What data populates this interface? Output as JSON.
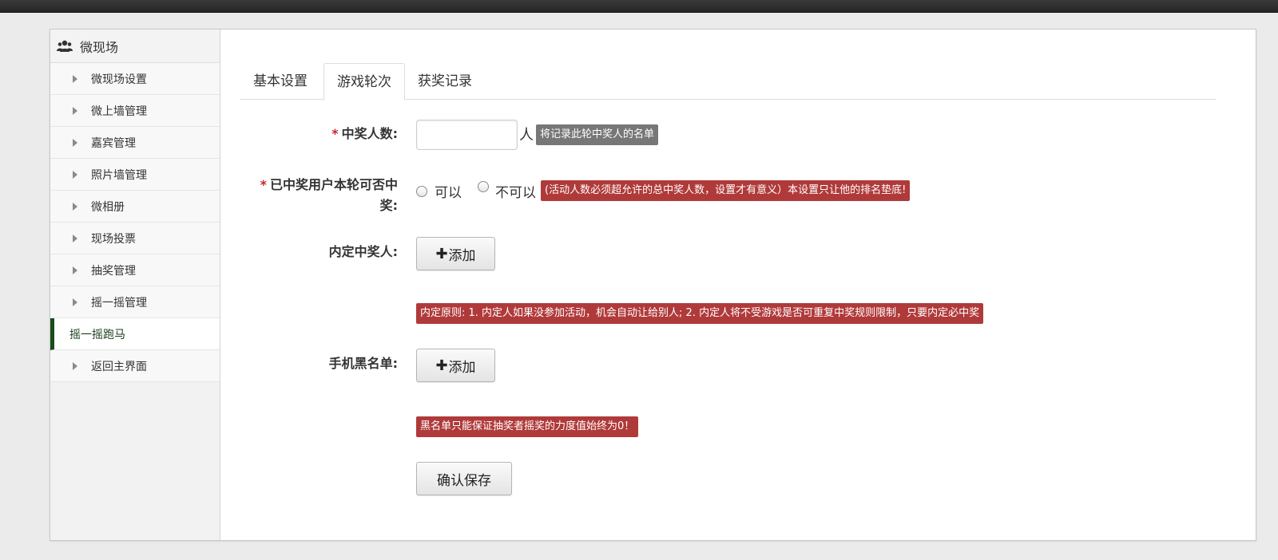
{
  "sidebar": {
    "title": "微现场",
    "title_icon": "users-icon",
    "items": [
      {
        "label": "微现场设置"
      },
      {
        "label": "微上墙管理"
      },
      {
        "label": "嘉宾管理"
      },
      {
        "label": "照片墙管理"
      },
      {
        "label": "微相册"
      },
      {
        "label": "现场投票"
      },
      {
        "label": "抽奖管理"
      },
      {
        "label": "摇一摇管理"
      },
      {
        "label": "摇一摇跑马",
        "active": true
      },
      {
        "label": "返回主界面"
      }
    ],
    "active_color": "#1a4c1a"
  },
  "tabs": [
    {
      "label": "基本设置"
    },
    {
      "label": "游戏轮次",
      "active": true
    },
    {
      "label": "获奖记录"
    }
  ],
  "form": {
    "winners_count": {
      "required_mark": "*",
      "label": "中奖人数:",
      "value": "",
      "unit": "人",
      "hint": "将记录此轮中奖人的名单"
    },
    "repeat_win": {
      "required_mark": "*",
      "label_line1": "已中奖用户本轮可否中",
      "label_line2": "奖:",
      "options": [
        "可以",
        "不可以"
      ],
      "selected": null,
      "hint": "(活动人数必须超允许的总中奖人数，设置才有意义）本设置只让他的排名垫底!"
    },
    "preset_winners": {
      "label": "内定中奖人:",
      "button_label": "添加",
      "note": "内定原则: 1. 内定人如果没参加活动，机会自动让给别人; 2. 内定人将不受游戏是否可重复中奖规则限制，只要内定必中奖"
    },
    "phone_blacklist": {
      "label": "手机黑名单:",
      "button_label": "添加",
      "note": "黑名单只能保证抽奖者摇奖的力度值始终为0！"
    },
    "save_label": "确认保存"
  },
  "colors": {
    "badge_red": "#b03a3a",
    "badge_grey": "#777777",
    "required": "#c62828"
  }
}
